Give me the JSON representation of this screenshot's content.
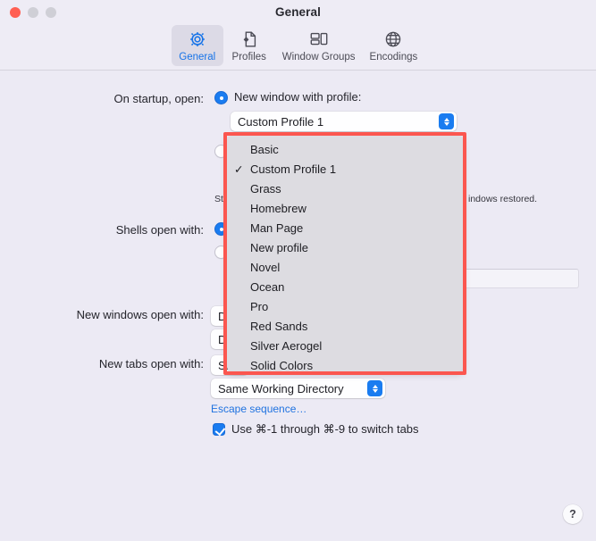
{
  "window": {
    "title": "General",
    "traffic_lights": [
      "close",
      "minimize",
      "maximize"
    ],
    "colors": {
      "accent": "#1a7cf0",
      "annotation": "#fb564f",
      "background": "#eceaf4",
      "titlebar": "#eeecf5",
      "menu_background": "#dddce1",
      "link": "#2073e0",
      "close_button": "#ff5f52"
    }
  },
  "toolbar": {
    "items": [
      {
        "label": "General",
        "icon": "gear-icon",
        "selected": true
      },
      {
        "label": "Profiles",
        "icon": "document-gear-icon",
        "selected": false
      },
      {
        "label": "Window Groups",
        "icon": "window-groups-icon",
        "selected": false
      },
      {
        "label": "Encodings",
        "icon": "globe-icon",
        "selected": false
      }
    ]
  },
  "main": {
    "startup": {
      "label": "On startup, open:",
      "option_new_window": {
        "text": "New window with profile:",
        "selected": true
      },
      "profile_select": {
        "value": "Custom Profile 1",
        "open": true
      },
      "option_window_groups": {
        "text": "",
        "selected": false
      },
      "note_visible_fragment": "indows restored.",
      "note_prefix_fragment": "Star"
    },
    "shells_open_with": {
      "label": "Shells open with:",
      "option_default_selected": true,
      "option_command_selected": false,
      "command_field_value": "",
      "command_field_placeholder": ""
    },
    "new_windows_open_with": {
      "label": "New windows open with:",
      "profile_select_fragment": "De",
      "directory_select_fragment": "De"
    },
    "new_tabs_open_with": {
      "label": "New tabs open with:",
      "profile_select_fragment": "Sa",
      "directory_select_value": "Same Working Directory"
    },
    "escape_sequence_link": "Escape sequence…",
    "switch_tabs_checkbox": {
      "label": "Use ⌘-1 through ⌘-9 to switch tabs",
      "checked": true
    }
  },
  "dropdown_menu": {
    "open": true,
    "selected_value": "Custom Profile 1",
    "check_glyph": "✓",
    "items": [
      {
        "label": "Basic",
        "checked": false
      },
      {
        "label": "Custom Profile 1",
        "checked": true
      },
      {
        "label": "Grass",
        "checked": false
      },
      {
        "label": "Homebrew",
        "checked": false
      },
      {
        "label": "Man Page",
        "checked": false
      },
      {
        "label": "New profile",
        "checked": false
      },
      {
        "label": "Novel",
        "checked": false
      },
      {
        "label": "Ocean",
        "checked": false
      },
      {
        "label": "Pro",
        "checked": false
      },
      {
        "label": "Red Sands",
        "checked": false
      },
      {
        "label": "Silver Aerogel",
        "checked": false
      },
      {
        "label": "Solid Colors",
        "checked": false
      }
    ]
  },
  "help_button": {
    "label": "?"
  }
}
